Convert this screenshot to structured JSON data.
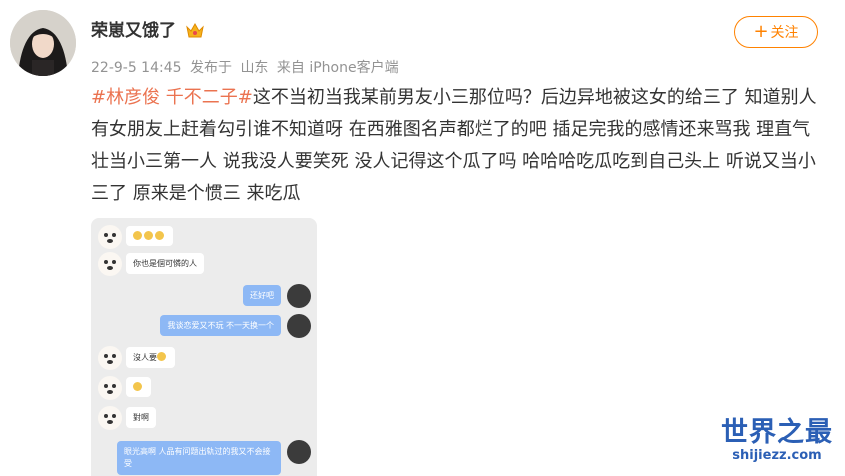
{
  "post": {
    "author": "荣崽又饿了",
    "meta": {
      "date": "22-9-5 14:45",
      "posted_label": "发布于",
      "location": "山东",
      "source": "来自 iPhone客户端"
    },
    "follow_label": "关注",
    "follow_plus": "+",
    "hashtag": "#林彦俊 千不二子#",
    "text": "这不当初当我某前男友小三那位吗？后边异地被这女的给三了 知道别人有女朋友上赶着勾引谁不知道呀 在西雅图名声都烂了的吧 插足完我的感情还来骂我 理直气壮当小三第一人 说我没人要笑死 没人记得这个瓜了吗 哈哈哈吃瓜吃到自己头上 听说又当小三了 原来是个惯三 来吃瓜"
  },
  "chat": {
    "messages": [
      {
        "side": "in",
        "text": ""
      },
      {
        "side": "in",
        "text": "你也是個可憐的人"
      },
      {
        "side": "out",
        "text": "还好吧"
      },
      {
        "side": "out",
        "text": "我谈恋爱又不玩 不一天换一个"
      },
      {
        "side": "in",
        "text": "沒人要"
      },
      {
        "side": "in",
        "text": ""
      },
      {
        "side": "in",
        "text": "對啊"
      },
      {
        "side": "out",
        "text": "眼光高啊 人品有问题出轨过的我又不会接受"
      }
    ]
  },
  "watermark": {
    "title": "世界之最",
    "url": "shijiezz.com"
  },
  "colors": {
    "accent": "#ff8200",
    "hashtag": "#eb7350",
    "meta": "#939393",
    "bubble_out": "#8db8f5",
    "watermark": "#2b5fb5"
  }
}
